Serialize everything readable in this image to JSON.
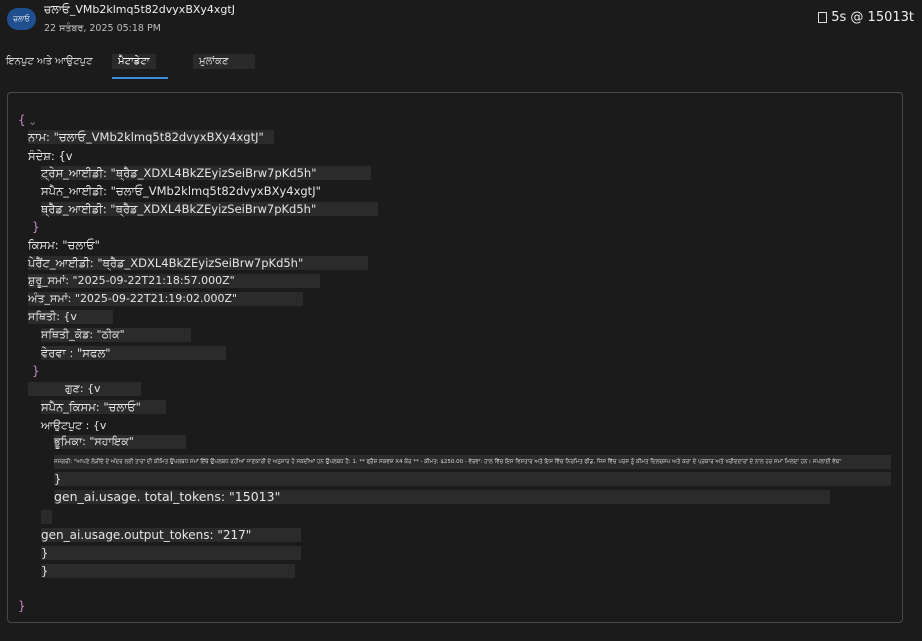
{
  "header": {
    "avatar_text": "ਚਲਾਓ",
    "title": "ਚਲਾਓ_VMb2klmq5t82dvyxBXy4xgtJ",
    "date": "22 ਸਤੰਬਰ, 2025 05:18 PM",
    "stats": "5s @ 15013t"
  },
  "tabs": [
    "ਇਨਪੁਟ ਅਤੇ ਆਉਟਪੁਟ",
    "ਮੈਟਾਡੇਟਾ",
    "ਮੁਲਾਂਕਣ"
  ],
  "json": {
    "open": "{",
    "collapse": "⌄",
    "name": "ਨਾਮ: \"ਚਲਾਓ_VMb2klmq5t82dvyxBXy4xgtJ\"",
    "context": "ਸੰਦੇਸ਼: {v",
    "trace_id": "ਟ੍ਰੇਸ_ਆਈਡੀ: \"ਥ੍ਰੈਡ_XDXL4BkZEyizSeiBrw7pKd5h\"",
    "span_id": "ਸਪੈਨ_ਆਈਡੀ: \"ਚਲਾਓ_VMb2klmq5t82dvyxBXy4xgtJ\"",
    "thread_id": "ਥ੍ਰੈਡ_ਆਈਡੀ: \"ਥ੍ਰੈਡ_XDXL4BkZEyizSeiBrw7pKd5h\"",
    "close_context": "}",
    "kind": "ਕਿਸਮ: \"ਚਲਾਓ\"",
    "parent_id": "ਪੇਰੈਂਟ_ਆਈਡੀ: \"ਥ੍ਰੈਡ_XDXL4BkZEyizSeiBrw7pKd5h\"",
    "start_time": "ਸ਼ੁਰੂ_ਸਮਾਂ: \"2025-09-22T21:18:57.000Z\"",
    "end_time": "ਅੰਤ_ਸਮਾਂ: \"2025-09-22T21:19:02.000Z\"",
    "status": "ਸਥਿਤੀ: {v",
    "status_code": "ਸਥਿਤੀ_ਕੋਡ: \"ਠੀਕ\"",
    "description": "ਵੇਰਵਾ : \"ਸਫਲ\"",
    "close_status": "}",
    "attributes": "ਗੁਣ: {v",
    "span_kind": "ਸਪੈਨ_ਕਿਸਮ: \"ਚਲਾਓ\"",
    "output": "ਆਉਟਪੁਟ : {v",
    "role": "ਭੂਮਿਕਾ: \"ਸਹਾਇਕ\"",
    "content": "ਸਮੱਗਰੀ: \"ਆਪਣੇ ਲੋੜੀਂਦੇ ਦੇ ਅੰਦਰ ਲਈ ਤਾਰਾਂ ਦੀ ਕੀਮਿਤ ਉਪਲਬਧ ਸਮਾਂ ਇੱਥੇ ਉਪਲਬਧ ਰਹੀਆਂ ਜਾਣਕਾਰੀ ਦੇ ਅਨੁਸਾਰ ਹੋ ਸਕਦੀਆਂ ਹਨ ਉਪਲਬਧ ਹੈ: 1. ** ਫ੍ਰੈਸ਼ ਸਕਵਸ਼ X4 ਕੋਰ ** - ਕੀਮਤ: $250.00 - ਵੇਰਵਾ: ਹਾਲ ਵਿੱਚ ਇਸ ਵਿਸਤਾਰ ਅਤੇ ਇਸ ਵਿੱਚ ਨਿਰਮਿਤ ਫੀਡ, ਜਿਸ ਵਿੱਚ ਪਰਸ ਨੂੰ ਕੀਮਤ ਦਿਲਚਸਪ ਅਤੇ ਕਰਾ ਦੇ ਪ੍ਰਕਾਰ ਅਤੇ ਖਰੀਦਦਾਰਾਂ ਦੇ ਨਾਲ ਹਰ ਸਮਾਂ ਮਿਲਦਾ ਹਨ। ਸਪਲਾਈ ਵੇਬ\"",
    "close_output": "}",
    "total_tokens": "gen_ai.usage. total_tokens: \"15013\"",
    "output_tokens": "gen_ai.usage.output_tokens: \"217\"",
    "close_attrs": "}",
    "close_root_inner": "}",
    "close_root": "}"
  }
}
